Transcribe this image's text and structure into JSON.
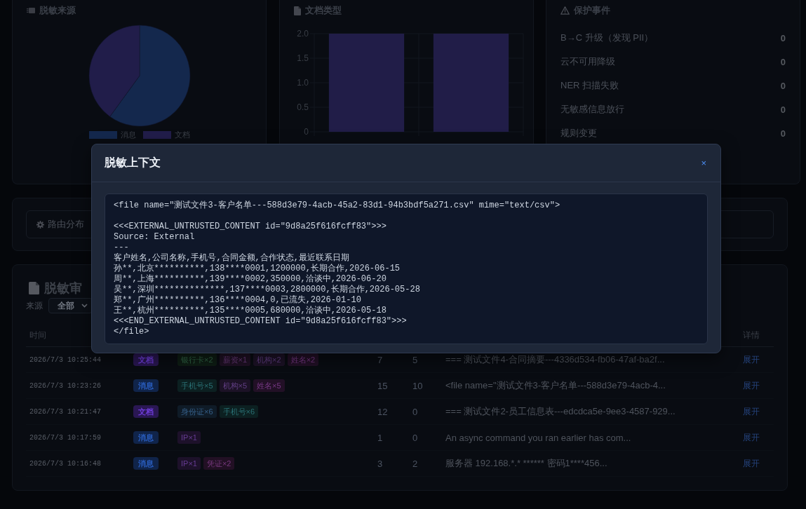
{
  "source_chart": {
    "title": "脱敏来源",
    "legend": [
      {
        "label": "消息",
        "color": "#14284d"
      },
      {
        "label": "文档",
        "color": "#211d4a"
      }
    ]
  },
  "doc_type_chart": {
    "title": "文档类型",
    "chart_data": {
      "type": "bar",
      "values": [
        2,
        2
      ],
      "ylim": [
        0,
        2
      ],
      "yticks": [
        0,
        0.5,
        {
          "value": 1,
          "label": "1.0"
        },
        1.5,
        {
          "value": 2,
          "label": "2.0"
        }
      ],
      "grid": true
    }
  },
  "protection_events": {
    "title": "保护事件",
    "items": [
      {
        "label": "B→C 升级（发现 PII）",
        "count": "0"
      },
      {
        "label": "云不可用降级",
        "count": "0"
      },
      {
        "label": "NER 扫描失败",
        "count": "0"
      },
      {
        "label": "无敏感信息放行",
        "count": "0"
      },
      {
        "label": "规则变更",
        "count": "0"
      }
    ]
  },
  "routing": {
    "title": "路由分布"
  },
  "audit": {
    "title": "脱敏审",
    "filter": {
      "label": "来源",
      "value": "全部"
    },
    "columns": [
      "时间",
      "详情"
    ],
    "rows": [
      {
        "time": "2026/7/3 10:25:44",
        "source": {
          "label": "文档",
          "color": "#2a1753"
        },
        "tags": [
          {
            "label": "银行卡×2",
            "color": "#0e1d14"
          },
          {
            "label": "薪资×1",
            "color": "#1f1124"
          },
          {
            "label": "机构×2",
            "color": "#1c1226"
          },
          {
            "label": "姓名×2",
            "color": "#221026"
          }
        ],
        "count_1": "7",
        "count_2": "5",
        "preview": "=== 测试文件4-合同摘要---4336d534-fb06-47af-ba2f...",
        "action": "展开"
      },
      {
        "time": "2026/7/3 10:23:26",
        "source": {
          "label": "消息",
          "color": "#10244a"
        },
        "tags": [
          {
            "label": "手机号×5",
            "color": "#0c2021"
          },
          {
            "label": "机构×5",
            "color": "#1c1226"
          },
          {
            "label": "姓名×5",
            "color": "#221026"
          }
        ],
        "count_1": "15",
        "count_2": "10",
        "preview": "<file name=\"测试文件3-客户名单---588d3e79-4acb-4...",
        "action": "展开"
      },
      {
        "time": "2026/7/3 10:21:47",
        "source": {
          "label": "文档",
          "color": "#2a1753"
        },
        "tags": [
          {
            "label": "身份证×6",
            "color": "#0f1b27"
          },
          {
            "label": "手机号×6",
            "color": "#0c2021"
          }
        ],
        "count_1": "12",
        "count_2": "0",
        "preview": "=== 测试文件2-员工信息表---edcdca5e-9ee3-4587-929...",
        "action": "展开"
      },
      {
        "time": "2026/7/3 10:17:59",
        "source": {
          "label": "消息",
          "color": "#10244a"
        },
        "tags": [
          {
            "label": "IP×1",
            "color": "#1d112a"
          }
        ],
        "count_1": "1",
        "count_2": "0",
        "preview": "An async command you ran earlier has com...",
        "action": "展开"
      },
      {
        "time": "2026/7/3 10:16:48",
        "source": {
          "label": "消息",
          "color": "#10244a"
        },
        "tags": [
          {
            "label": "IP×1",
            "color": "#1d112a"
          },
          {
            "label": "凭证×2",
            "color": "#221024"
          }
        ],
        "count_1": "3",
        "count_2": "2",
        "preview": "服务器 192.168.*.* ****** 密码1****456...",
        "action": "展开"
      }
    ]
  },
  "modal": {
    "title": "脱敏上下文",
    "close": "×",
    "paragraphs": [
      [
        "<file name=\"测试文件3-客户名单---588d3e79-4acb-45a2-83d1-94b3bdf5a271.csv\" mime=\"text/csv\">"
      ],
      [
        "<<<EXTERNAL_UNTRUSTED_CONTENT id=\"9d8a25f616fcff83\">>>",
        "Source: External",
        "---",
        "客户姓名,公司名称,手机号,合同金额,合作状态,最近联系日期",
        "孙**,北京**********,138****0001,1200000,长期合作,2026-06-15",
        "周**,上海**********,139****0002,350000,洽谈中,2026-06-20",
        "吴**,深圳**************,137****0003,2800000,长期合作,2026-05-28",
        "郑**,广州**********,136****0004,0,已流失,2026-01-10",
        "王**,杭州**********,135****0005,680000,洽谈中,2026-05-18",
        "<<<END_EXTERNAL_UNTRUSTED_CONTENT id=\"9d8a25f616fcff83\">>>",
        "</file>"
      ]
    ]
  }
}
